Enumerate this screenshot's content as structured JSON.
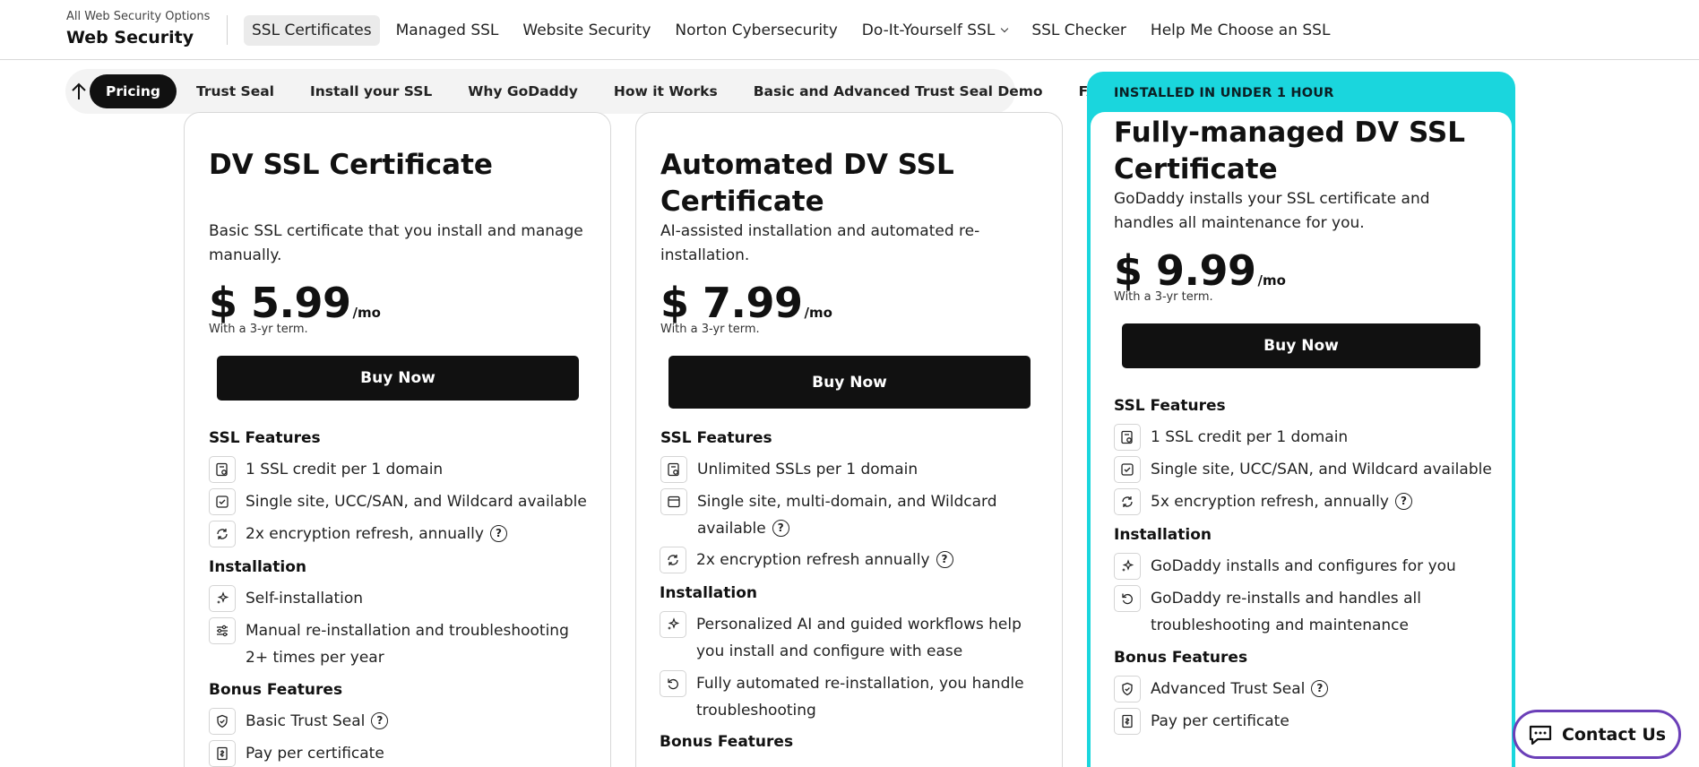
{
  "header": {
    "brand_small": "All Web Security Options",
    "brand_title": "Web Security",
    "nav": [
      "SSL Certificates",
      "Managed SSL",
      "Website Security",
      "Norton Cybersecurity",
      "Do-It-Yourself SSL",
      "SSL Checker",
      "Help Me Choose an SSL"
    ],
    "nav_active": "SSL Certificates"
  },
  "subnav": {
    "items": [
      "Pricing",
      "Trust Seal",
      "Install your SSL",
      "Why GoDaddy",
      "How it Works",
      "Basic and Advanced Trust Seal Demo",
      "FAQ"
    ],
    "active": "Pricing"
  },
  "colors": {
    "accent_teal": "#1ad6dd",
    "contact_border": "#6b3fb8",
    "button_dark": "#111111"
  },
  "cards": [
    {
      "title": "DV SSL Certificate",
      "description": "Basic SSL certificate that you install and manage manually.",
      "price": "$ 5.99",
      "price_unit": "/mo",
      "term": "With a 3-yr term.",
      "buy_label": "Buy Now",
      "ssl_heading": "SSL Features",
      "ssl_features": [
        {
          "text": "1 SSL credit per 1 domain",
          "icon": "certificate-icon"
        },
        {
          "text": "Single site, UCC/SAN, and Wildcard available",
          "icon": "checkbox-icon"
        },
        {
          "text": "2x encryption refresh, annually",
          "icon": "refresh-icon",
          "help": "?"
        }
      ],
      "install_heading": "Installation",
      "install_features": [
        {
          "text": "Self-installation",
          "icon": "sparkle-icon"
        },
        {
          "text": "Manual re-installation and troubleshooting 2+ times per year",
          "icon": "sliders-icon"
        }
      ],
      "bonus_heading": "Bonus Features",
      "bonus_features": [
        {
          "text": "Basic Trust Seal",
          "icon": "shield-icon",
          "help": "?"
        },
        {
          "text": "Pay per certificate",
          "icon": "receipt-icon"
        }
      ]
    },
    {
      "title": "Automated DV SSL Certificate",
      "description": "AI-assisted installation and automated re-installation.",
      "price": "$ 7.99",
      "price_unit": "/mo",
      "term": "With a 3-yr term.",
      "buy_label": "Buy Now",
      "ssl_heading": "SSL Features",
      "ssl_features": [
        {
          "text": "Unlimited SSLs per 1 domain",
          "icon": "certificate-icon"
        },
        {
          "text": "Single site, multi-domain, and Wildcard available",
          "icon": "browser-icon",
          "help": "?"
        },
        {
          "text": "2x encryption refresh annually",
          "icon": "refresh-icon",
          "help": "?"
        }
      ],
      "install_heading": "Installation",
      "install_features": [
        {
          "text": "Personalized AI and guided workflows help you install and configure with ease",
          "icon": "sparkle-icon"
        },
        {
          "text": "Fully automated re-installation, you handle troubleshooting",
          "icon": "undo-icon"
        }
      ],
      "bonus_heading": "Bonus Features"
    },
    {
      "badge": "INSTALLED IN UNDER 1 HOUR",
      "title": "Fully-managed DV SSL Certificate",
      "description": "GoDaddy installs your SSL certificate and handles all maintenance for you.",
      "price": "$ 9.99",
      "price_unit": "/mo",
      "term": "With a 3-yr term.",
      "buy_label": "Buy Now",
      "ssl_heading": "SSL Features",
      "ssl_features": [
        {
          "text": "1 SSL credit per 1 domain",
          "icon": "certificate-icon"
        },
        {
          "text": "Single site, UCC/SAN, and Wildcard available",
          "icon": "checkbox-icon"
        },
        {
          "text": "5x encryption refresh, annually",
          "icon": "refresh-icon",
          "help": "?"
        }
      ],
      "install_heading": "Installation",
      "install_features": [
        {
          "text": "GoDaddy installs and configures for you",
          "icon": "sparkle-icon"
        },
        {
          "text": "GoDaddy re-installs and handles all troubleshooting and maintenance",
          "icon": "undo-icon"
        }
      ],
      "bonus_heading": "Bonus Features",
      "bonus_features": [
        {
          "text": "Advanced Trust Seal",
          "icon": "shield-icon",
          "help": "?"
        },
        {
          "text": "Pay per certificate",
          "icon": "receipt-icon"
        }
      ]
    }
  ],
  "contact": {
    "label": "Contact Us",
    "icon": "chat-icon"
  }
}
